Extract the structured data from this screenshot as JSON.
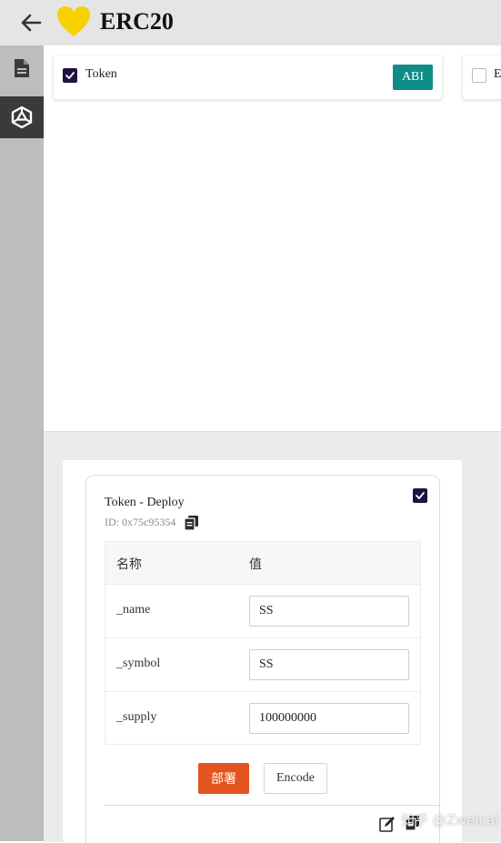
{
  "header": {
    "title": "ERC20",
    "back_icon": "arrow-left-icon",
    "logo_icon": "heart-icon",
    "logo_color": "#f5d200"
  },
  "sidebar": {
    "items": [
      {
        "icon": "file-icon",
        "active": false
      },
      {
        "icon": "solidity-icon",
        "active": true
      }
    ]
  },
  "contracts": {
    "tabs": [
      {
        "label": "Token",
        "checked": true,
        "abi_label": "ABI"
      },
      {
        "label": "E",
        "checked": false
      }
    ]
  },
  "deploy": {
    "title": "Token - Deploy",
    "id": "ID: 0x75c95354",
    "checked": true,
    "table": {
      "col_name": "名称",
      "col_value": "值",
      "rows": [
        {
          "name": "_name",
          "value": "SS"
        },
        {
          "name": "_symbol",
          "value": "SS"
        },
        {
          "name": "_supply",
          "value": "100000000"
        }
      ]
    },
    "deploy_label": "部署",
    "encode_label": "Encode"
  },
  "watermark": "知乎 @Zweicai",
  "colors": {
    "abi": "#0e8c87",
    "deploy": "#e3541f",
    "checkbox": "#1e1240"
  }
}
